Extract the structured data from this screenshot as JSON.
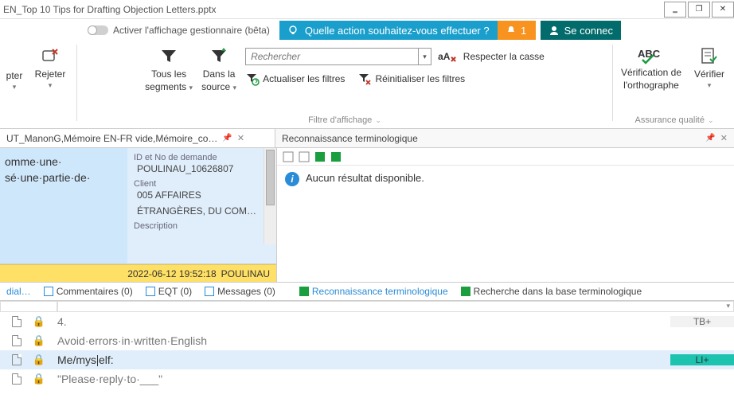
{
  "window": {
    "title": "EN_Top 10 Tips for Drafting Objection Letters.pptx"
  },
  "toggle": {
    "label": "Activer l'affichage gestionnaire (bêta)"
  },
  "ask": {
    "text": "Quelle  action  souhaitez-vous  effectuer ?"
  },
  "notif": {
    "count": "1"
  },
  "signin": {
    "label": "Se connec"
  },
  "ribbon": {
    "pter": "pter",
    "rejeter": "Rejeter",
    "tousSegments1": "Tous les",
    "tousSegments2": "segments",
    "dansSource1": "Dans la",
    "dansSource2": "source",
    "searchPlaceholder": "Rechercher",
    "respectCase": "Respecter la casse",
    "actualiser": "Actualiser les filtres",
    "reinit": "Réinitialiser les filtres",
    "filtreGroup": "Filtre d'affichage",
    "spell1": "Vérification de",
    "spell2": "l'orthographe",
    "verify": "Vérifier",
    "qaGroup": "Assurance qualité"
  },
  "doctab": {
    "label": "UT_ManonG,Mémoire  EN-FR  vide,Mémoire_co…"
  },
  "segment": {
    "line1": "omme·une·",
    "line2": "sé·une·partie·de·",
    "metaIdLbl": "ID et No de demande",
    "metaIdVal": "POULINAU_10626807",
    "metaClientLbl": "Client",
    "metaClientVal1": "005  AFFAIRES",
    "metaClientVal2": "ÉTRANGÈRES,  DU COM…",
    "descLbl": "Description",
    "timestamp": "2022-06-12 19:52:18",
    "user": "POULINAU"
  },
  "term": {
    "title": "Reconnaissance terminologique",
    "noresult": "Aucun résultat disponible."
  },
  "tabs": {
    "dial": "dial…",
    "comments": "Commentaires (0)",
    "eqt": "EQT (0)",
    "messages": "Messages (0)",
    "termrecon": "Reconnaissance terminologique",
    "termsearch": "Recherche dans la base terminologique"
  },
  "rows": {
    "r1num": "4.",
    "r2text": "Avoid·errors·in·written·English",
    "r3text": "Me/myself:",
    "r4text": "\"Please·reply·to·___\"",
    "tb": "TB+",
    "li": "LI+"
  }
}
